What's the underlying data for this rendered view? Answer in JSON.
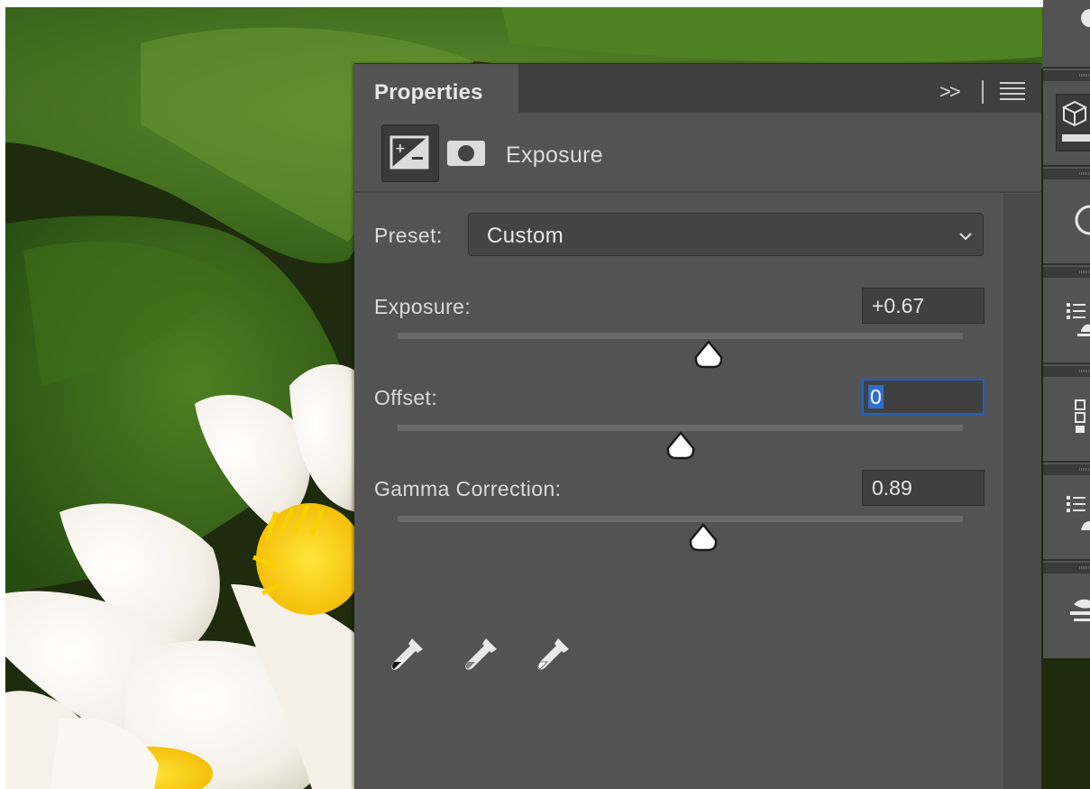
{
  "panel": {
    "title": "Properties",
    "collapse_icon": "double-chevron-right-icon",
    "menu_icon": "hamburger-menu-icon",
    "adjustment_icon": "exposure-adjustment-icon",
    "mask_icon": "layer-mask-icon",
    "adjustment_name": "Exposure",
    "preset": {
      "label": "Preset:",
      "value": "Custom"
    },
    "sliders": [
      {
        "label": "Exposure:",
        "value": "+0.67",
        "position": 0.551
      },
      {
        "label": "Offset:",
        "value": "0",
        "position": 0.5,
        "active": true
      },
      {
        "label": "Gamma Correction:",
        "value": "0.89",
        "position": 0.541
      }
    ],
    "eyedroppers": [
      "black-point-eyedropper-icon",
      "gray-point-eyedropper-icon",
      "white-point-eyedropper-icon"
    ]
  },
  "dock": {
    "icons": [
      "cube-icon",
      "circle-icon",
      "list-icon",
      "layers-icon",
      "list-icon",
      "leaf-icon"
    ]
  },
  "colors": {
    "panel_bg": "#535353",
    "tab_bar_bg": "#3f3f3f",
    "field_focus": "#1a64c8",
    "selection": "#2d6fd1"
  }
}
